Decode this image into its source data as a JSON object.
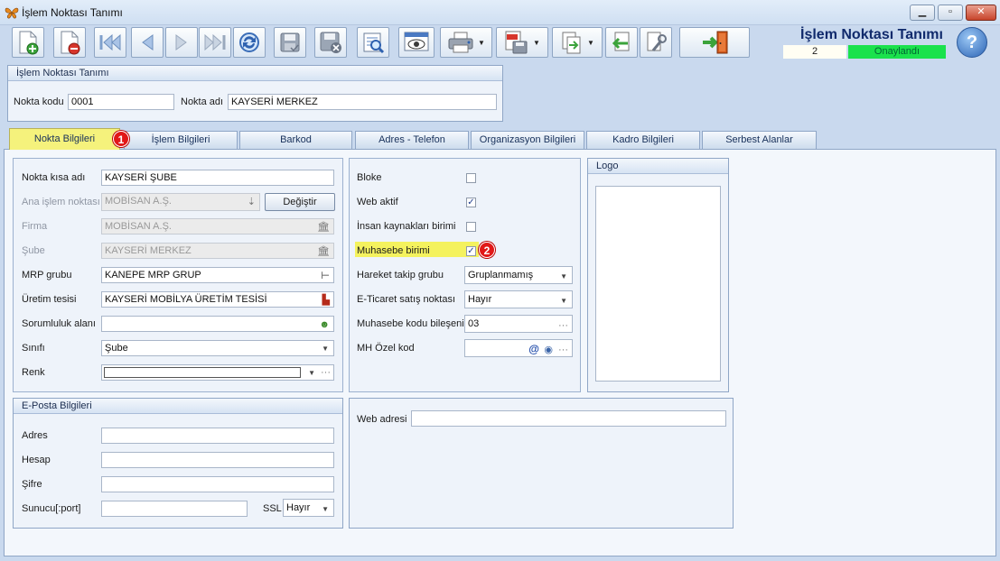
{
  "window": {
    "title": "İşlem Noktası Tanımı",
    "icon": "butterfly-icon",
    "minimize_symbol": "▁",
    "maximize_symbol": "▫",
    "close_symbol": "✕"
  },
  "toolbar": {
    "buttons": [
      {
        "name": "new-record-icon"
      },
      {
        "name": "delete-record-icon"
      },
      {
        "name": "first-record-icon"
      },
      {
        "name": "previous-record-icon"
      },
      {
        "name": "next-record-icon"
      },
      {
        "name": "last-record-icon"
      },
      {
        "name": "refresh-icon"
      },
      {
        "name": "save-icon"
      },
      {
        "name": "save-close-icon"
      },
      {
        "name": "search-document-icon"
      },
      {
        "name": "preview-icon"
      },
      {
        "name": "print-icon"
      },
      {
        "name": "pdf-export-icon"
      },
      {
        "name": "export-icon"
      },
      {
        "name": "import-icon"
      },
      {
        "name": "tools-icon"
      },
      {
        "name": "exit-icon"
      }
    ],
    "dropdown_caret": "▼"
  },
  "header": {
    "title": "İşlem Noktası Tanımı",
    "count": "2",
    "status": "Onaylandı",
    "help_symbol": "?"
  },
  "definition": {
    "group_title": "İşlem Noktası Tanımı",
    "code_label": "Nokta kodu",
    "code_value": "0001",
    "name_label": "Nokta adı",
    "name_value": "KAYSERİ MERKEZ"
  },
  "tabs": [
    {
      "label": "Nokta Bilgileri",
      "active": true
    },
    {
      "label": "İşlem Bilgileri"
    },
    {
      "label": "Barkod"
    },
    {
      "label": "Adres - Telefon"
    },
    {
      "label": "Organizasyon Bilgileri"
    },
    {
      "label": "Kadro Bilgileri"
    },
    {
      "label": "Serbest Alanlar"
    }
  ],
  "badges": {
    "one": "1",
    "two": "2"
  },
  "point_info": {
    "short_name": {
      "label": "Nokta kısa adı",
      "value": "KAYSERİ ŞUBE"
    },
    "main_point": {
      "label": "Ana işlem noktası",
      "value": "MOBİSAN A.Ş.",
      "button": "Değiştir"
    },
    "company": {
      "label": "Firma",
      "value": "MOBİSAN A.Ş."
    },
    "branch": {
      "label": "Şube",
      "value": "KAYSERİ MERKEZ"
    },
    "mrp_group": {
      "label": "MRP grubu",
      "value": "KANEPE MRP GRUP"
    },
    "facility": {
      "label": "Üretim tesisi",
      "value": "KAYSERİ MOBİLYA ÜRETİM TESİSİ"
    },
    "responsibility": {
      "label": "Sorumluluk alanı",
      "value": ""
    },
    "class": {
      "label": "Sınıfı",
      "value": "Şube"
    },
    "color": {
      "label": "Renk",
      "value": ""
    }
  },
  "flags": {
    "blocked": {
      "label": "Bloke",
      "checked": false
    },
    "web_active": {
      "label": "Web aktif",
      "checked": true
    },
    "hr_unit": {
      "label": "İnsan kaynakları birimi",
      "checked": false
    },
    "accounting_unit": {
      "label": "Muhasebe birimi",
      "checked": true
    },
    "movement_group": {
      "label": "Hareket takip grubu",
      "value": "Gruplanmamış"
    },
    "ecommerce_point": {
      "label": "E-Ticaret satış noktası",
      "value": "Hayır"
    },
    "accounting_code": {
      "label": "Muhasebe kodu bileşeni",
      "value": "03"
    },
    "mh_special_code": {
      "label": "MH Özel kod",
      "value": ""
    },
    "check_mark": "✓",
    "ellipsis": "···"
  },
  "logo": {
    "title": "Logo"
  },
  "email": {
    "title": "E-Posta Bilgileri",
    "address": {
      "label": "Adres",
      "value": ""
    },
    "account": {
      "label": "Hesap",
      "value": ""
    },
    "password": {
      "label": "Şifre",
      "value": ""
    },
    "server": {
      "label": "Sunucu[:port]",
      "value": ""
    },
    "ssl": {
      "label": "SSL",
      "value": "Hayır"
    }
  },
  "web": {
    "label": "Web adresi",
    "value": ""
  }
}
